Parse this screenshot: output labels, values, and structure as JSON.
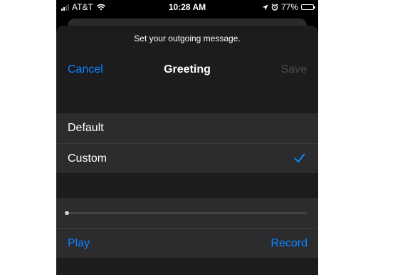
{
  "status_bar": {
    "carrier": "AT&T",
    "time": "10:28 AM",
    "battery": "77%",
    "battery_level": 0.77,
    "icons": [
      "signal-icon",
      "wifi-icon",
      "location-icon",
      "alarm-icon",
      "battery-icon"
    ]
  },
  "sheet": {
    "prompt": "Set your outgoing message.",
    "cancel_label": "Cancel",
    "title": "Greeting",
    "save_label": "Save"
  },
  "greeting_options": {
    "items": [
      {
        "label": "Default",
        "selected": false
      },
      {
        "label": "Custom",
        "selected": true
      }
    ]
  },
  "playback": {
    "progress": 0,
    "play_label": "Play",
    "record_label": "Record"
  },
  "colors": {
    "accent": "#0a84ff",
    "background": "#000000",
    "sheet": "#1c1c1e",
    "cell": "#2c2c2e",
    "disabled": "#4a4a4c"
  }
}
